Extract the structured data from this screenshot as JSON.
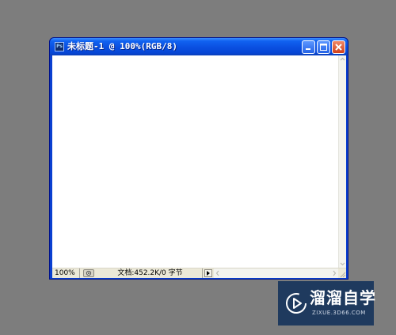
{
  "window": {
    "title": "未标题-1 @ 100%(RGB/8)",
    "app_icon_label": "Ps"
  },
  "statusbar": {
    "zoom": "100%",
    "doc_info": "文档:452.2K/0 字节"
  },
  "watermark": {
    "brand": "溜溜自学",
    "url": "ZIXUE.3D66.COM"
  },
  "colors": {
    "workspace": "#7d7d7d",
    "titlebar": "#0a4fe0",
    "canvas": "#ffffff",
    "watermark_bg": "#1f3a5e"
  },
  "icons": {
    "minimize": "minimize-icon",
    "maximize": "maximize-icon",
    "close": "close-icon",
    "navigator": "navigator-icon",
    "status_arrow": "play-arrow-icon",
    "logo": "play-logo-icon"
  }
}
